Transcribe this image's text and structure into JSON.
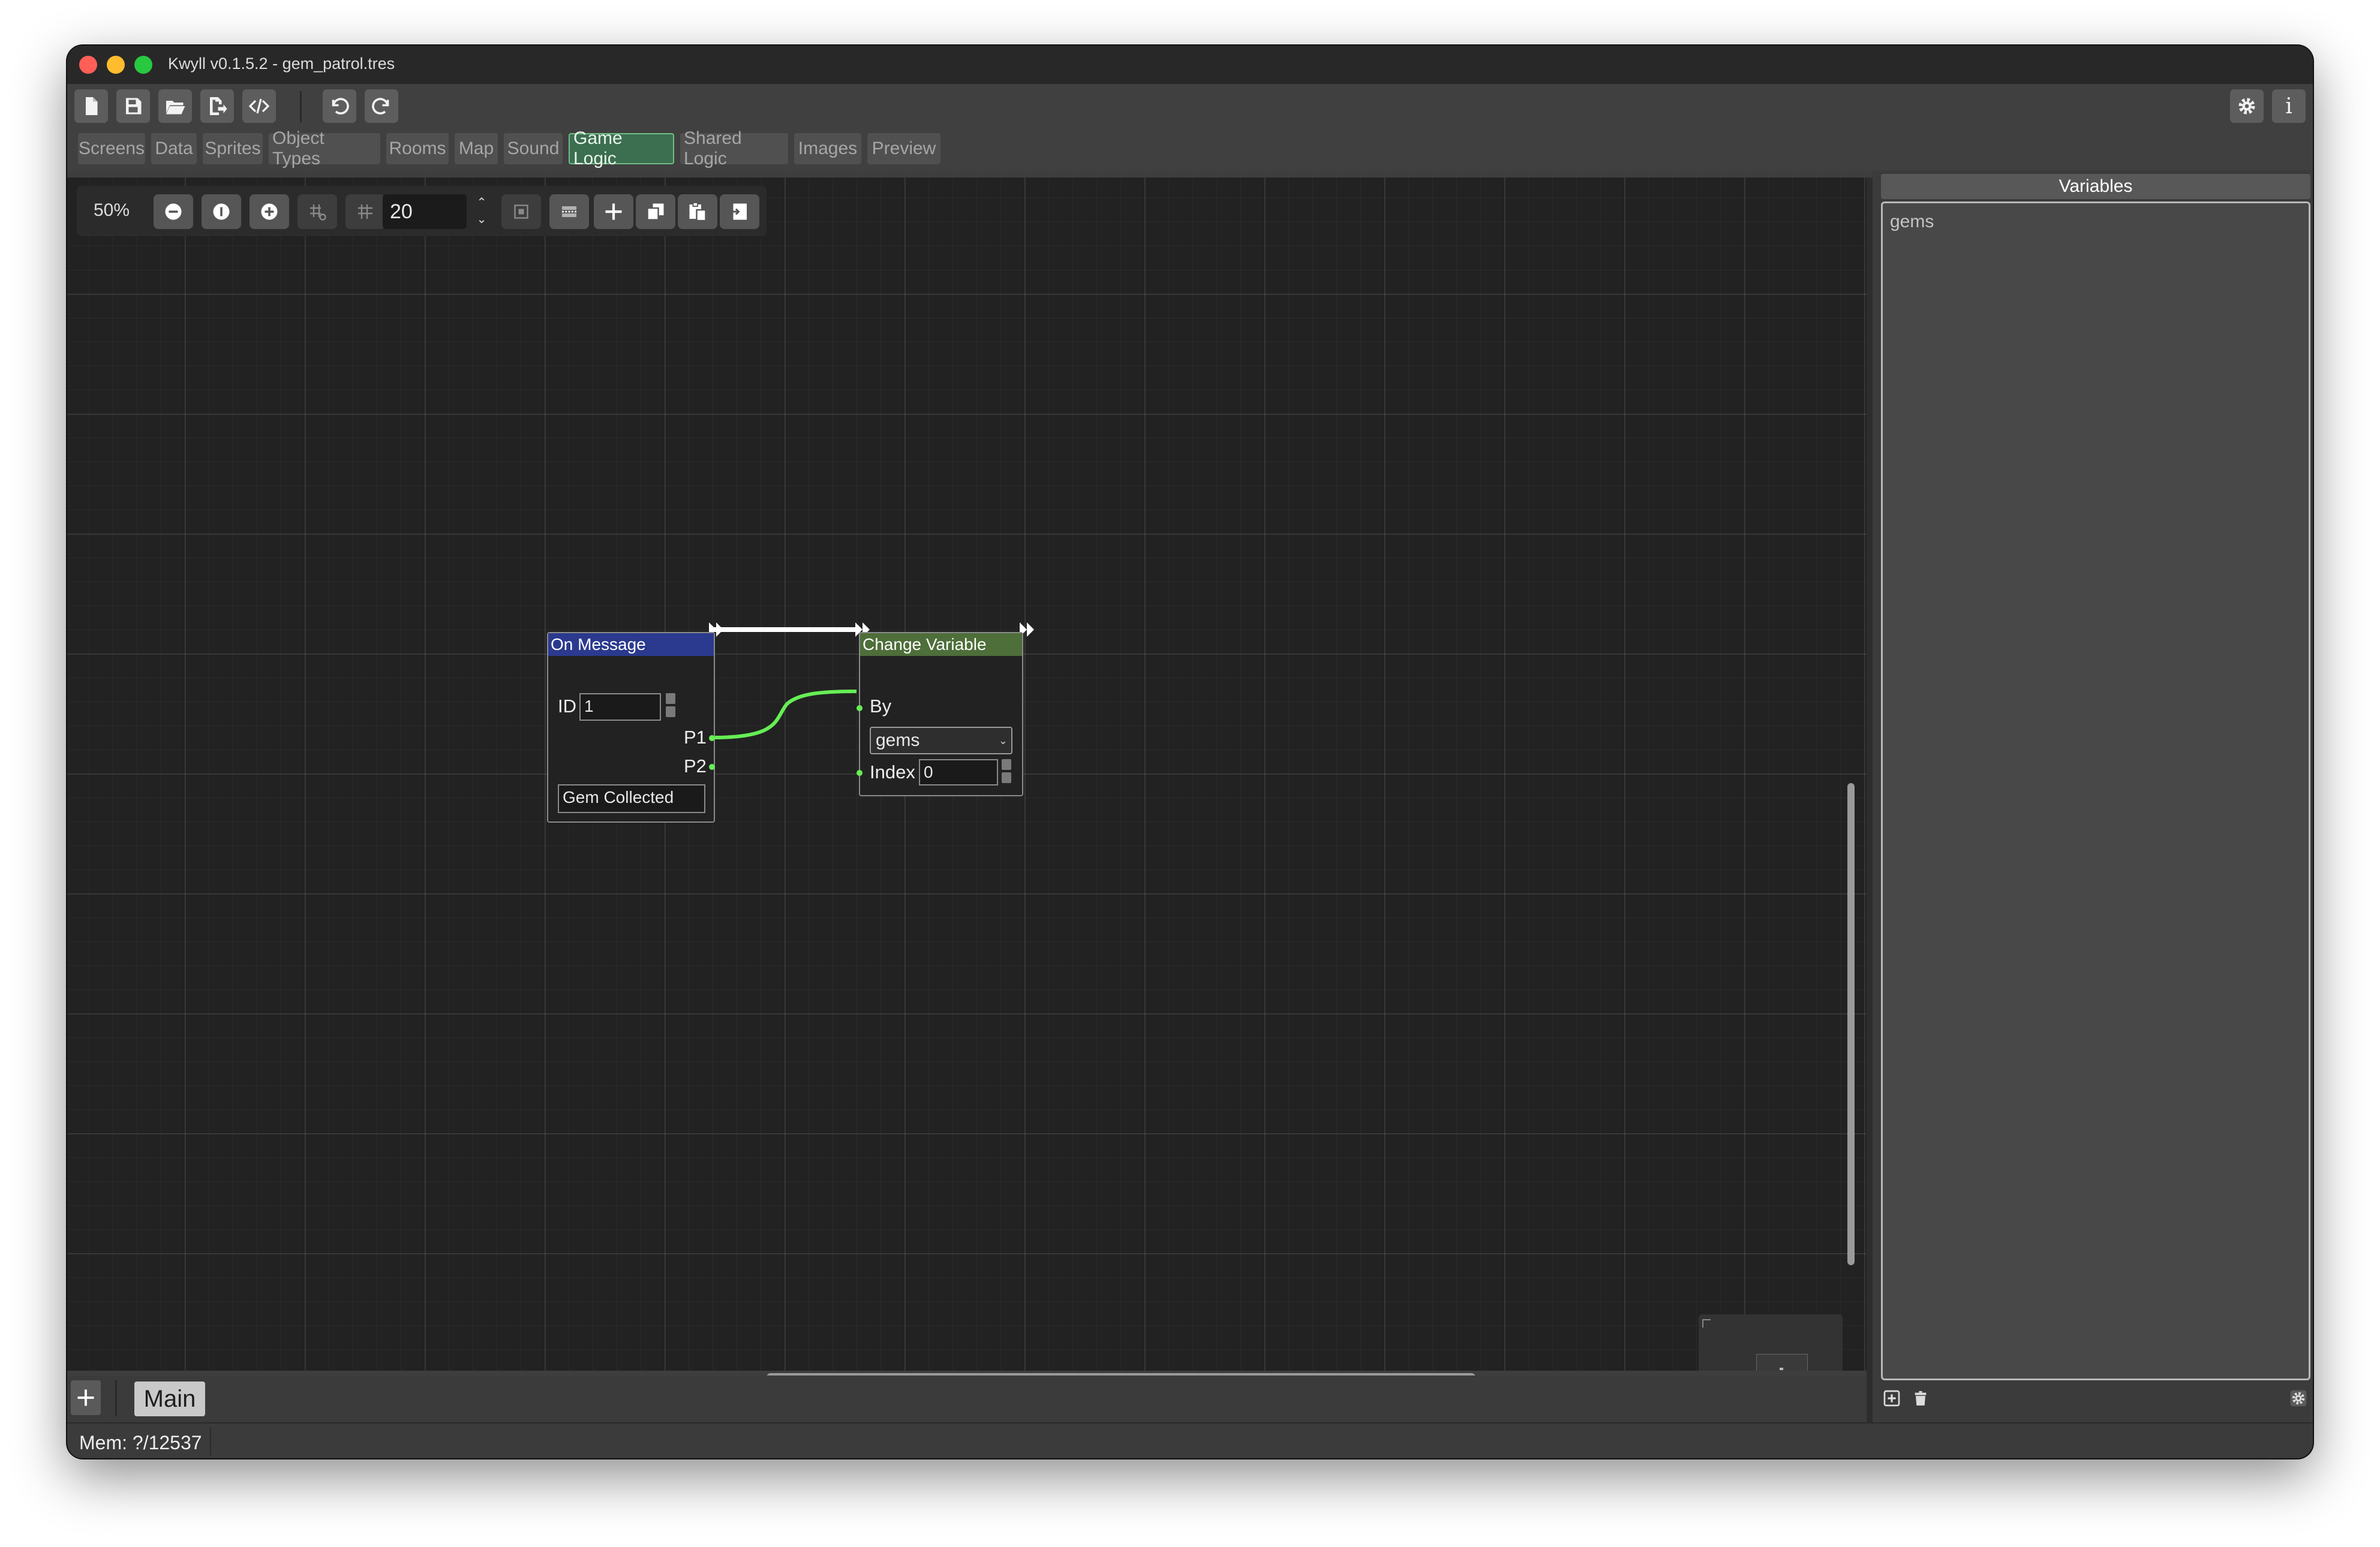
{
  "window": {
    "title": "Kwyll v0.1.5.2 - gem_patrol.tres",
    "traffic_colors": {
      "close": "#ff5f57",
      "minimize": "#febc2e",
      "maximize": "#28c840"
    }
  },
  "toolbar": {
    "buttons": [
      "new-file-icon",
      "save-icon",
      "open-folder-icon",
      "export-icon",
      "code-icon",
      "undo-icon",
      "redo-icon"
    ],
    "right_buttons": [
      "gear-icon",
      "info-icon"
    ],
    "info_glyph": "i"
  },
  "tabs": [
    "Screens",
    "Data",
    "Sprites",
    "Object Types",
    "Rooms",
    "Map",
    "Sound",
    "Game Logic",
    "Shared Logic",
    "Images",
    "Preview"
  ],
  "active_tab": "Game Logic",
  "graph_toolbar": {
    "zoom": "50%",
    "snap_value": "20",
    "buttons": [
      "zoom-out-icon",
      "zoom-reset-icon",
      "zoom-in-icon",
      "grid-snap-icon",
      "grid-toggle-icon",
      "minimap-icon",
      "arrange-icon",
      "add-node-icon",
      "copy-icon",
      "paste-icon",
      "duplicate-icon"
    ]
  },
  "nodes": {
    "on_message": {
      "title": "On Message",
      "header_color": "#2b3a8f",
      "id_label": "ID",
      "id_value": "1",
      "p1_label": "P1",
      "p2_label": "P2",
      "message_value": "Gem Collected"
    },
    "change_variable": {
      "title": "Change Variable",
      "header_color": "#4e6e3a",
      "by_label": "By",
      "variable_value": "gems",
      "index_label": "Index",
      "index_value": "0"
    }
  },
  "wire_colors": {
    "flow": "#ffffff",
    "data": "#66ee55"
  },
  "variables_panel": {
    "title": "Variables",
    "items": [
      "gems"
    ]
  },
  "pages": {
    "add_label": "+",
    "tabs": [
      "Main"
    ]
  },
  "status": {
    "memory": "Mem: ?/12537"
  }
}
